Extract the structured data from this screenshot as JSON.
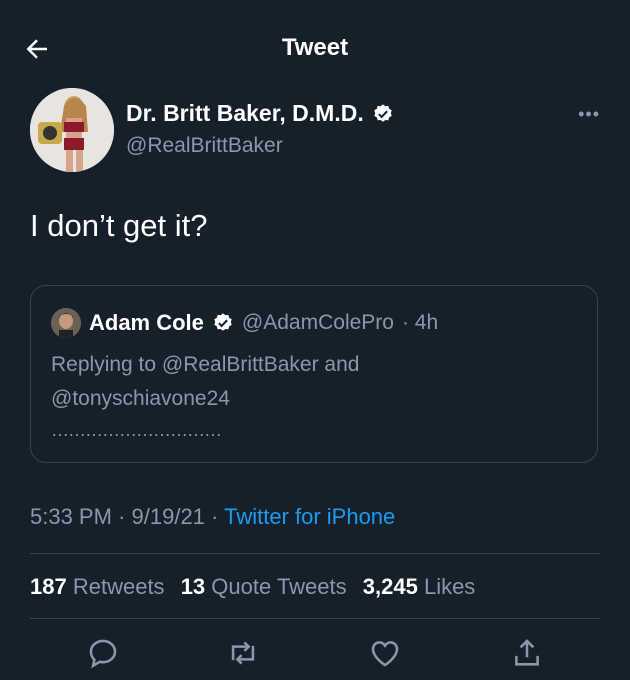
{
  "header": {
    "title": "Tweet"
  },
  "author": {
    "name": "Dr. Britt Baker, D.M.D.",
    "handle": "@RealBrittBaker"
  },
  "tweet": {
    "text": "I don’t get it?"
  },
  "quote": {
    "name": "Adam Cole",
    "handle": "@AdamColePro",
    "time": "· 4h",
    "reply_line1": "Replying to @RealBrittBaker and",
    "reply_line2": "@tonyschiavone24",
    "body": "…………………………"
  },
  "meta": {
    "time": "5:33 PM",
    "sep1": "·",
    "date": "9/19/21",
    "sep2": "·",
    "source": "Twitter for iPhone"
  },
  "stats": {
    "retweets": "187",
    "retweets_label": "Retweets",
    "quotes": "13",
    "quotes_label": "Quote Tweets",
    "likes": "3,245",
    "likes_label": "Likes"
  },
  "icons": {
    "back": "arrow-left-icon",
    "verified": "verified-badge-icon",
    "more": "more-dots-icon",
    "reply": "reply-icon",
    "retweet": "retweet-icon",
    "like": "heart-icon",
    "share": "share-icon"
  },
  "colors": {
    "background": "#15202b",
    "accent": "#1d9bf0",
    "muted": "#8b98a5",
    "border": "#38444d"
  }
}
